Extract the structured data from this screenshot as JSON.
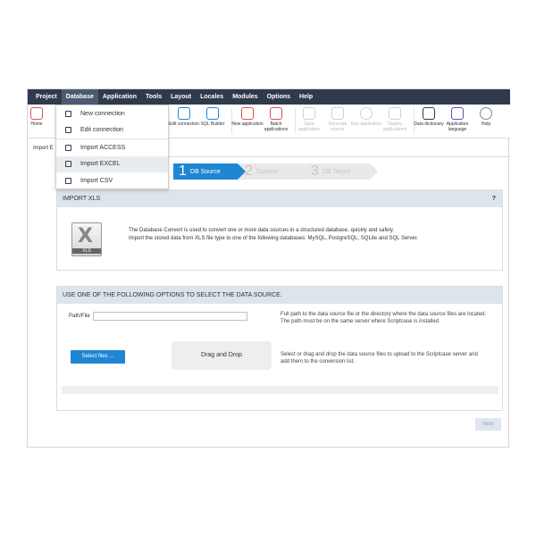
{
  "menubar": {
    "items": [
      "Project",
      "Database",
      "Application",
      "Tools",
      "Layout",
      "Locales",
      "Modules",
      "Options",
      "Help"
    ],
    "active": "Database"
  },
  "toolbar": {
    "home": "Home",
    "items": [
      {
        "label": "Edit connection",
        "icon": "database-edit-icon",
        "enabled": true
      },
      {
        "label": "SQL Builder",
        "icon": "database-sql-icon",
        "enabled": true
      },
      {
        "label": "New application",
        "icon": "new-application-icon",
        "enabled": true
      },
      {
        "label": "Batch applications",
        "icon": "batch-applications-icon",
        "enabled": true
      },
      {
        "label": "Save application",
        "icon": "save-icon",
        "enabled": false
      },
      {
        "label": "Generate source",
        "icon": "generate-icon",
        "enabled": false
      },
      {
        "label": "Run application",
        "icon": "run-icon",
        "enabled": false
      },
      {
        "label": "Deploy applications",
        "icon": "deploy-icon",
        "enabled": false
      },
      {
        "label": "Data dictionary",
        "icon": "data-dictionary-icon",
        "enabled": true
      },
      {
        "label": "Application language",
        "icon": "language-icon",
        "enabled": true
      },
      {
        "label": "Help",
        "icon": "help-icon",
        "enabled": true
      }
    ]
  },
  "tab": {
    "label": "Import E"
  },
  "dropdown": {
    "items": [
      {
        "label": "New connection",
        "icon": "new-connection-icon"
      },
      {
        "label": "Edit connection",
        "icon": "edit-connection-icon"
      },
      {
        "label": "Import ACCESS",
        "icon": "access-icon"
      },
      {
        "label": "Import EXCEL",
        "icon": "excel-icon"
      },
      {
        "label": "Import CSV",
        "icon": "csv-icon"
      }
    ]
  },
  "wizard": {
    "steps": [
      {
        "num": "1",
        "label": "DB Source",
        "active": true
      },
      {
        "num": "2",
        "label": "Options",
        "active": false
      },
      {
        "num": "3",
        "label": "DB Target",
        "active": false
      }
    ]
  },
  "import_panel": {
    "title": "IMPORT XLS",
    "help": "?",
    "icon_text": "XLS",
    "desc_line1": "The Database Convert is used to convert one or more data sources in a structured database, quickly and safely.",
    "desc_line2": "Import the stored data from XLS file type to one of the following databases: MySQL, PostgreSQL, SQLite and SQL Server."
  },
  "source_panel": {
    "title": "USE ONE OF THE FOLLOWING OPTIONS TO SELECT THE DATA SOURCE.",
    "path_label": "Path/File",
    "path_value": "",
    "path_note_1": "Full path to the data source file or the directory where the data source files are located.",
    "path_note_2": "The path must be on the same server where Scriptcase is installed",
    "select_label": "Select files ...",
    "drop_label": "Drag and Drop",
    "drop_note_1": "Select or drag and drop the data source files to upload to the Scriptcase server and",
    "drop_note_2": "add them to the conversion list."
  },
  "next_label": "Next",
  "colors": {
    "menubar": "#2f3b4c",
    "accent": "#1e86d3",
    "panel_head": "#dde4ec"
  }
}
